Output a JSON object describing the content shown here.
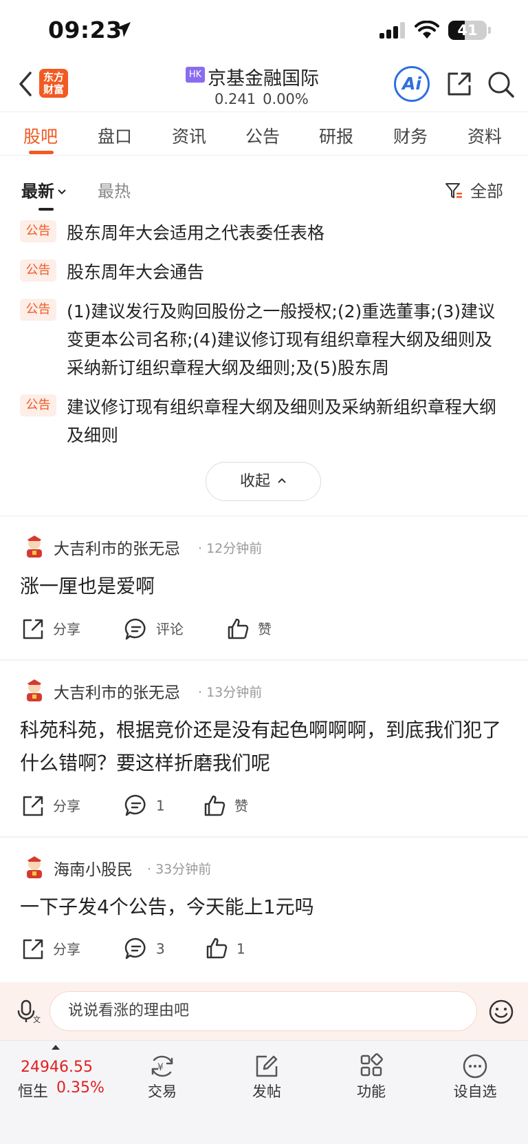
{
  "status_bar": {
    "time": "09:23",
    "battery": "41"
  },
  "header": {
    "logo": [
      "东方",
      "财富"
    ],
    "market_badge": "HK",
    "stock_name": "京基金融国际",
    "price": "0.241",
    "change": "0.00%",
    "ai_label": "Ai"
  },
  "tabs": [
    "股吧",
    "盘口",
    "资讯",
    "公告",
    "研报",
    "财务",
    "资料"
  ],
  "filters": {
    "newest": "最新",
    "hottest": "最热",
    "all": "全部"
  },
  "announcements": [
    {
      "tag": "公告",
      "text": "股东周年大会适用之代表委任表格"
    },
    {
      "tag": "公告",
      "text": "股东周年大会通告"
    },
    {
      "tag": "公告",
      "text": "(1)建议发行及购回股份之一般授权;(2)重选董事;(3)建议变更本公司名称;(4)建议修订现有组织章程大纲及细则及采纳新订组织章程大纲及细则;及(5)股东周"
    },
    {
      "tag": "公告",
      "text": "建议修订现有组织章程大纲及细则及采纳新组织章程大纲及细则"
    }
  ],
  "collapse_label": "收起",
  "posts": [
    {
      "author": "大吉利市的张无忌",
      "time": "· 12分钟前",
      "content": "涨一厘也是爱啊",
      "share": "分享",
      "comment": "评论",
      "like": "赞"
    },
    {
      "author": "大吉利市的张无忌",
      "time": "· 13分钟前",
      "content": "科苑科苑，根据竞价还是没有起色啊啊啊，到底我们犯了什么错啊？要这样折磨我们呢",
      "share": "分享",
      "comment": "1",
      "like": "赞"
    },
    {
      "author": "海南小股民",
      "time": "· 33分钟前",
      "content": "一下子发4个公告，今天能上1元吗",
      "share": "分享",
      "comment": "3",
      "like": "1"
    }
  ],
  "comment_input": {
    "placeholder": "说说看涨的理由吧"
  },
  "bottom_nav": {
    "index_value": "24946.55",
    "index_name": "恒生",
    "index_change": "0.35%",
    "items": [
      "交易",
      "发帖",
      "功能",
      "设自选"
    ]
  },
  "colors": {
    "accent": "#f15a22",
    "up_red": "#e02020",
    "ai_blue": "#2d6fe0",
    "hk_badge": "#8a6cf0"
  }
}
